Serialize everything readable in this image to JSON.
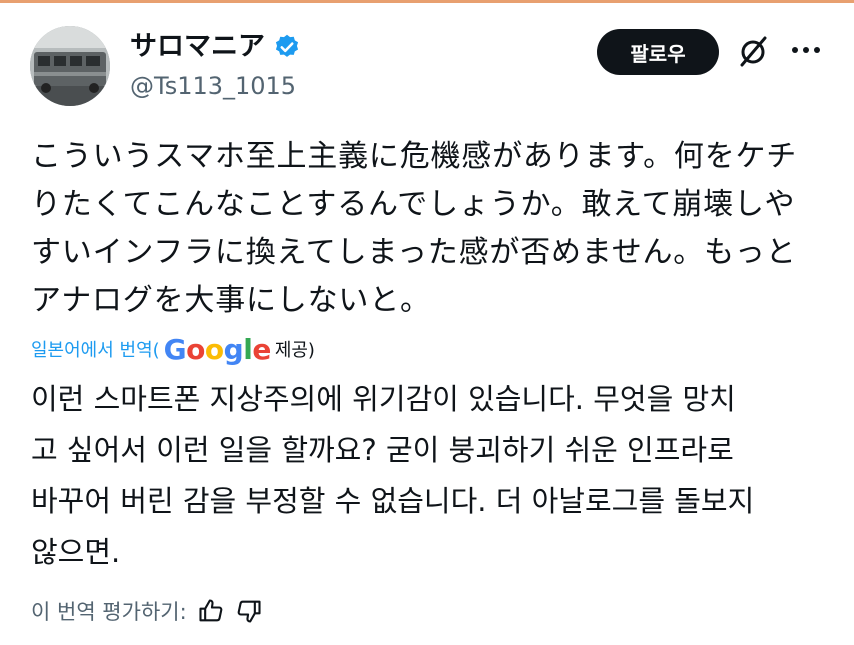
{
  "profile": {
    "display_name": "サロマニア",
    "handle": "@Ts113_1015",
    "verified": true,
    "avatar_icon": "train-photo-avatar"
  },
  "actions": {
    "follow_label": "팔로우",
    "grok_icon": "grok-icon",
    "more_icon": "more-icon"
  },
  "tweet": {
    "original_lines": [
      "こういうスマホ至上主義に危機感があります。何をケチ",
      "りたくてこんなことするんでしょうか。敢えて崩壊しや",
      "すいインフラに換えてしまった感が否めません。もっと",
      "アナログを大事にしないと。"
    ],
    "translation_prefix": "일본어에서 번역(",
    "google_letters": [
      "G",
      "o",
      "o",
      "g",
      "l",
      "e"
    ],
    "translation_suffix": "제공)",
    "translated_lines": [
      "이런 스마트폰 지상주의에 위기감이 있습니다. 무엇을 망치",
      "고 싶어서 이런 일을 할까요? 굳이 붕괴하기 쉬운 인프라로",
      "바꾸어 버린 감을 부정할 수 없습니다. 더 아날로그를 돌보지",
      "않으면."
    ]
  },
  "rating": {
    "label": "이 번역 평가하기:",
    "thumbs_up_icon": "thumbs-up-icon",
    "thumbs_down_icon": "thumbs-down-icon"
  },
  "colors": {
    "verified": "#1d9bf0",
    "link": "#1d9bf0",
    "secondary_text": "#536471",
    "follow_bg": "#0f1419"
  }
}
